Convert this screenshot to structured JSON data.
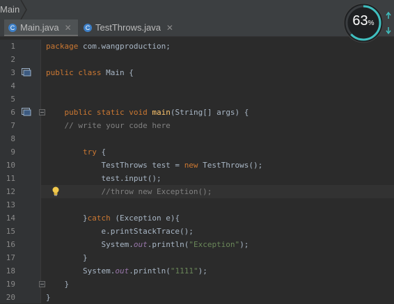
{
  "breadcrumb": {
    "label": "Main"
  },
  "tabs": [
    {
      "label": "Main.java",
      "icon": "java-class-icon",
      "active": true
    },
    {
      "label": "TestThrows.java",
      "icon": "java-class-icon",
      "active": false
    }
  ],
  "gauge": {
    "value": "63",
    "unit": "%",
    "ring_color": "#3fbfbf"
  },
  "lines": [
    {
      "n": "1"
    },
    {
      "n": "2"
    },
    {
      "n": "3"
    },
    {
      "n": "4"
    },
    {
      "n": "5"
    },
    {
      "n": "6"
    },
    {
      "n": "7"
    },
    {
      "n": "8"
    },
    {
      "n": "9"
    },
    {
      "n": "10"
    },
    {
      "n": "11"
    },
    {
      "n": "12"
    },
    {
      "n": "13"
    },
    {
      "n": "14"
    },
    {
      "n": "15"
    },
    {
      "n": "16"
    },
    {
      "n": "17"
    },
    {
      "n": "18"
    },
    {
      "n": "19"
    },
    {
      "n": "20"
    }
  ],
  "code": {
    "l1": [
      "package",
      " com.wangproduction;"
    ],
    "l3": [
      "public class",
      " Main {"
    ],
    "l6": [
      "    ",
      "public static void",
      " ",
      "main",
      "(String[] args) {"
    ],
    "l7": [
      "    // write your code here"
    ],
    "l9": [
      "        ",
      "try",
      " {"
    ],
    "l10": [
      "            TestThrows test = ",
      "new",
      " TestThrows();"
    ],
    "l11": [
      "            test.input();"
    ],
    "l12": [
      "            //throw new Exception();"
    ],
    "l14": [
      "        }",
      "catch",
      " (Exception e){"
    ],
    "l15": [
      "            e.printStackTrace();"
    ],
    "l16": [
      "            System.",
      "out",
      ".println(",
      "\"Exception\"",
      ");"
    ],
    "l17": [
      "        }"
    ],
    "l18": [
      "        System.",
      "out",
      ".println(",
      "\"1111\"",
      ");"
    ],
    "l19": [
      "    }"
    ],
    "l20": [
      "}"
    ]
  },
  "colors": {
    "keyword": "#cc7832",
    "function": "#ffc66d",
    "string": "#6a8759",
    "comment": "#808080",
    "field": "#9876aa",
    "text": "#a9b7c6"
  }
}
